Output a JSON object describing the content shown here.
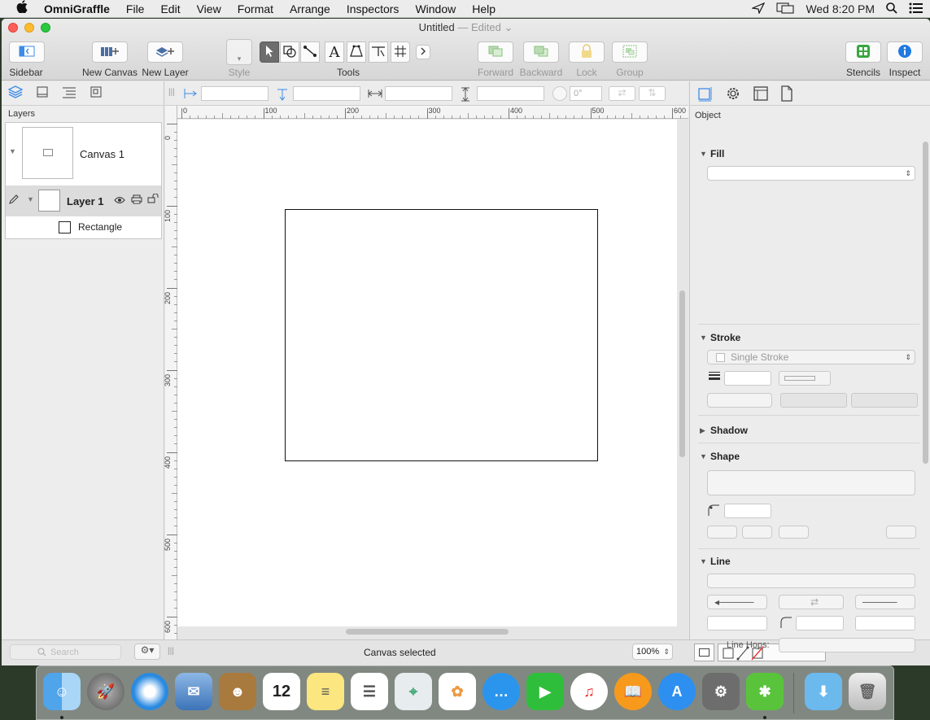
{
  "menubar": {
    "apple": "",
    "app_name": "OmniGraffle",
    "menus": [
      "File",
      "Edit",
      "View",
      "Format",
      "Arrange",
      "Inspectors",
      "Window",
      "Help"
    ],
    "clock": "Wed 8:20 PM"
  },
  "window": {
    "title": "Untitled",
    "title_status": "— Edited"
  },
  "toolbar": {
    "sidebar_label": "Sidebar",
    "new_canvas_label": "New Canvas",
    "new_layer_label": "New Layer",
    "style_label": "Style",
    "tools_label": "Tools",
    "forward_label": "Forward",
    "backward_label": "Backward",
    "lock_label": "Lock",
    "group_label": "Group",
    "stencils_label": "Stencils",
    "inspect_label": "Inspect",
    "text_tool_glyph": "A"
  },
  "sidebar": {
    "section_label": "Layers",
    "canvas_name": "Canvas 1",
    "layer_name": "Layer 1",
    "object_name": "Rectangle",
    "search_placeholder": "Search"
  },
  "inspector_bar": {
    "rotation_placeholder": "0°"
  },
  "ruler": {
    "h_ticks": [
      "0",
      "100",
      "200",
      "300",
      "400",
      "500",
      "600"
    ],
    "v_ticks": [
      "0",
      "100",
      "200",
      "300",
      "400",
      "500",
      "600"
    ]
  },
  "status": {
    "text": "Canvas selected",
    "zoom": "100%"
  },
  "inspector": {
    "title": "Object",
    "fill_label": "Fill",
    "stroke_label": "Stroke",
    "stroke_type": "Single Stroke",
    "shadow_label": "Shadow",
    "shape_label": "Shape",
    "line_label": "Line",
    "line_hops_label": "Line Hops:"
  },
  "colors": {
    "accent": "#3d8be8",
    "stencils_green": "#3aa640",
    "inspect_blue": "#1f7ae0"
  }
}
